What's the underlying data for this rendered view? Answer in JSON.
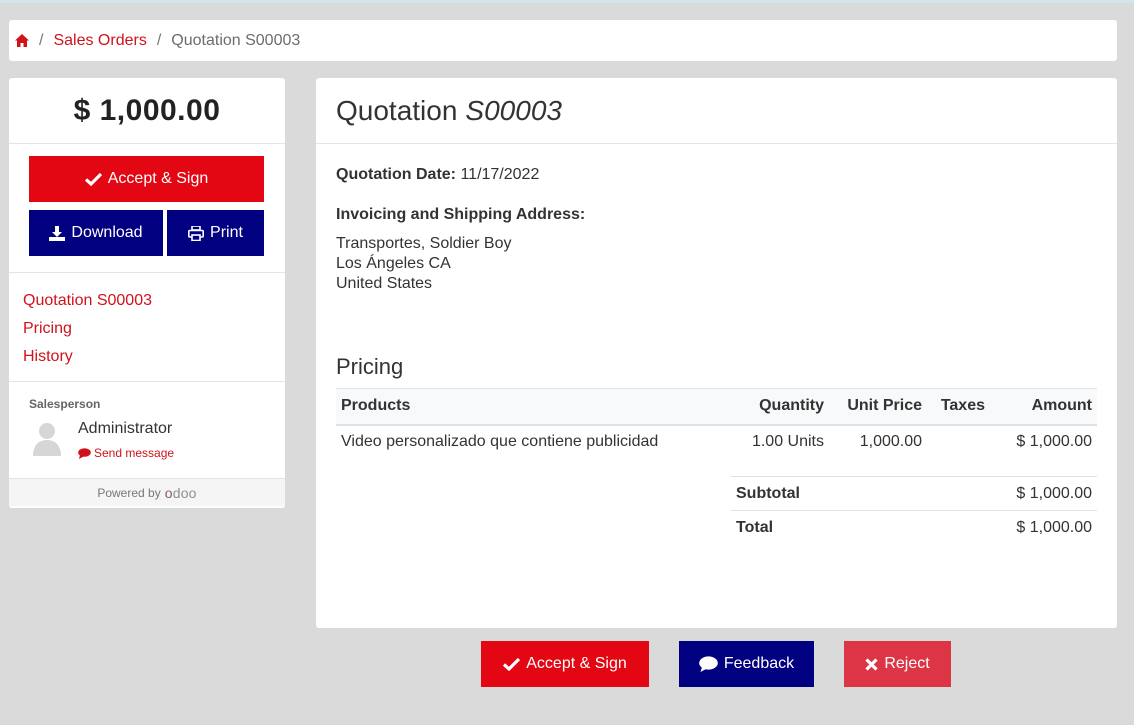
{
  "breadcrumb": {
    "home_icon": "home-icon",
    "items": [
      "Sales Orders",
      "Quotation S00003"
    ],
    "separator": "/"
  },
  "sidebar": {
    "amount": "$ 1,000.00",
    "accept_label": "Accept & Sign",
    "download_label": "Download",
    "print_label": "Print",
    "nav": [
      "Quotation S00003",
      "Pricing",
      "History"
    ],
    "salesperson_label": "Salesperson",
    "salesperson_name": "Administrator",
    "send_message_label": "Send message",
    "powered_by": "Powered by",
    "powered_logo_text": "odoo"
  },
  "main": {
    "title_prefix": "Quotation",
    "title_number": "S00003",
    "date_label": "Quotation Date:",
    "date_value": "11/17/2022",
    "address_label": "Invoicing and Shipping Address:",
    "address_lines": [
      "Transportes, Soldier Boy",
      "Los Ángeles CA",
      "United States"
    ],
    "pricing_heading": "Pricing",
    "columns": [
      "Products",
      "Quantity",
      "Unit Price",
      "Taxes",
      "Amount"
    ],
    "rows": [
      {
        "product": "Video personalizado que contiene publicidad",
        "quantity": "1.00 Units",
        "unit_price": "1,000.00",
        "taxes": "",
        "amount": "$ 1,000.00"
      }
    ],
    "subtotal_label": "Subtotal",
    "subtotal_value": "$ 1,000.00",
    "total_label": "Total",
    "total_value": "$ 1,000.00"
  },
  "bottom_actions": {
    "accept_label": "Accept & Sign",
    "feedback_label": "Feedback",
    "reject_label": "Reject"
  },
  "colors": {
    "accent_red": "#e30613",
    "link_red": "#d0121b",
    "navy": "#000080",
    "reject_pink": "#dc3545",
    "background": "#dadada"
  }
}
